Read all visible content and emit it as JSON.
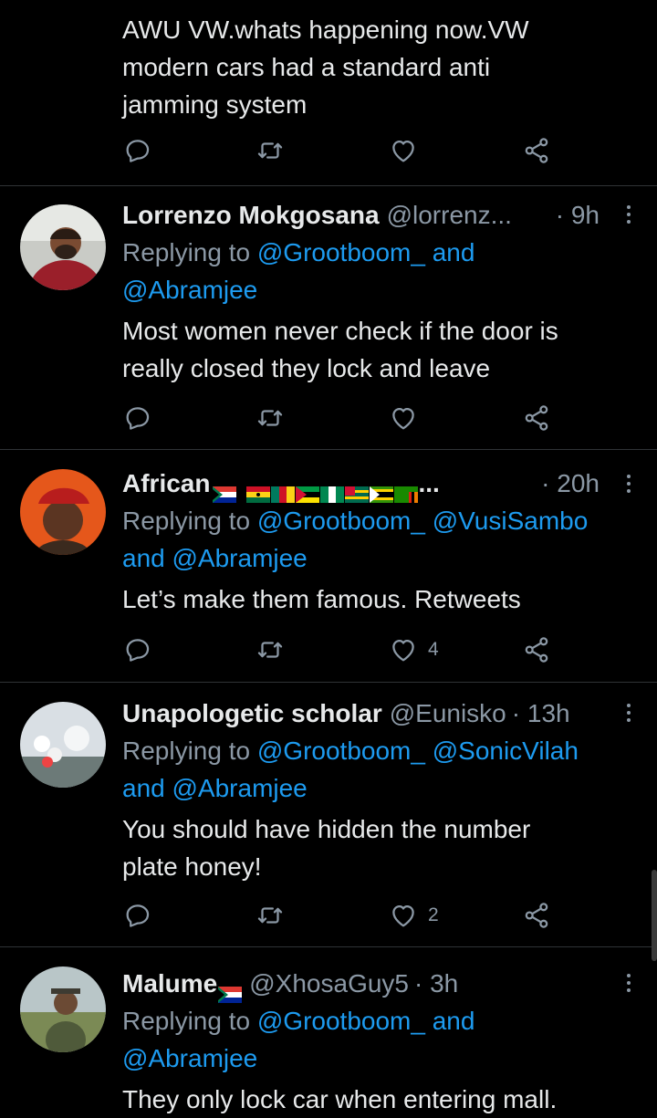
{
  "top_tweet": {
    "lines": [
      "AWU VW.whats happening now.VW",
      "modern cars had a standard anti",
      "jamming system"
    ]
  },
  "tweets": [
    {
      "name": "Lorrenzo Mokgosana",
      "handle": "@lorrenz...",
      "time": "· 9h",
      "reply_prefix": "Replying to ",
      "reply_line1": "@Grootboom_ and",
      "reply_line2": "@Abramjee",
      "body": [
        "Most women never check if the door is",
        "really closed they lock and leave"
      ]
    },
    {
      "name": "African",
      "flags_suffix": "...",
      "time": "· 20h",
      "reply_prefix": "Replying to ",
      "reply_line1": "@Grootboom_ @VusiSambo",
      "reply_line2": "and @Abramjee",
      "body": [
        "Let’s make them famous. Retweets"
      ],
      "like_count": "4"
    },
    {
      "name": "Unapologetic scholar",
      "handle": "@Eunisko",
      "time": "· 13h",
      "reply_prefix": "Replying to ",
      "reply_line1": "@Grootboom_ @SonicVilah",
      "reply_line2": "and @Abramjee",
      "body": [
        "You should have hidden the number",
        "plate honey!"
      ],
      "like_count": "2"
    },
    {
      "name": "Malume",
      "handle": "@XhosaGuy5",
      "time": "· 3h",
      "reply_prefix": "Replying to ",
      "reply_line1": "@Grootboom_ and",
      "reply_line2": "@Abramjee",
      "body": [
        "They only lock car when entering mall."
      ]
    }
  ],
  "colors": {
    "background": "#000000",
    "text": "#e7e9ea",
    "muted": "#8b98a5",
    "link": "#1d9bf0",
    "divider": "#2f3336"
  },
  "icons": [
    "reply-icon",
    "retweet-icon",
    "like-icon",
    "share-icon",
    "more-icon"
  ]
}
